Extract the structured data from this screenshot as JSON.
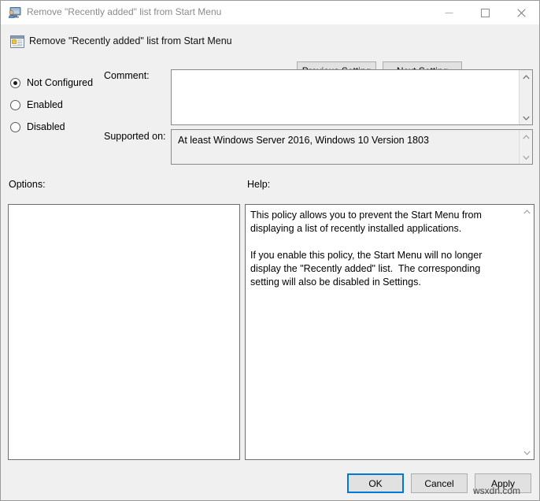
{
  "window": {
    "title": "Remove \"Recently added\" list from Start Menu",
    "title_icon": "group-policy-computer-icon",
    "controls": {
      "minimize": "minimize-icon",
      "maximize": "maximize-icon",
      "close": "close-icon"
    }
  },
  "header": {
    "icon": "policy-setting-icon",
    "title": "Remove \"Recently added\" list from Start Menu",
    "previous_setting_label": "Previous Setting",
    "next_setting_label": "Next Setting"
  },
  "state_options": {
    "items": [
      {
        "label": "Not Configured",
        "selected": true
      },
      {
        "label": "Enabled",
        "selected": false
      },
      {
        "label": "Disabled",
        "selected": false
      }
    ]
  },
  "comment": {
    "label": "Comment:",
    "value": "",
    "placeholder": ""
  },
  "supported_on": {
    "label": "Supported on:",
    "value": "At least Windows Server 2016, Windows 10 Version 1803"
  },
  "options": {
    "label": "Options:",
    "content": ""
  },
  "help": {
    "label": "Help:",
    "text": "This policy allows you to prevent the Start Menu from displaying a list of recently installed applications.\n\nIf you enable this policy, the Start Menu will no longer display the \"Recently added\" list.  The corresponding setting will also be disabled in Settings."
  },
  "footer": {
    "ok_label": "OK",
    "cancel_label": "Cancel",
    "apply_label": "Apply"
  },
  "watermark": {
    "text": "wsxdn.com"
  },
  "colors": {
    "accent": "#0078d7",
    "window_bg": "#f0f0f0",
    "titlebar_bg": "#ffffff",
    "field_bg": "#ffffff",
    "disabled_field_bg": "#f0f0f0",
    "border": "#898989",
    "title_text": "#8a8a8a"
  }
}
